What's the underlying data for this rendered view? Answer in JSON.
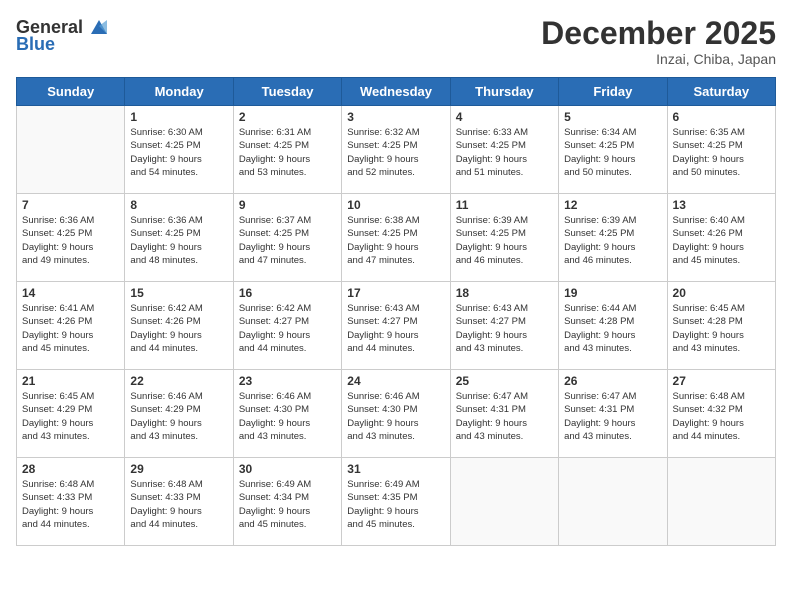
{
  "logo": {
    "general": "General",
    "blue": "Blue"
  },
  "title": "December 2025",
  "location": "Inzai, Chiba, Japan",
  "days_of_week": [
    "Sunday",
    "Monday",
    "Tuesday",
    "Wednesday",
    "Thursday",
    "Friday",
    "Saturday"
  ],
  "weeks": [
    [
      {
        "day": "",
        "lines": []
      },
      {
        "day": "1",
        "lines": [
          "Sunrise: 6:30 AM",
          "Sunset: 4:25 PM",
          "Daylight: 9 hours",
          "and 54 minutes."
        ]
      },
      {
        "day": "2",
        "lines": [
          "Sunrise: 6:31 AM",
          "Sunset: 4:25 PM",
          "Daylight: 9 hours",
          "and 53 minutes."
        ]
      },
      {
        "day": "3",
        "lines": [
          "Sunrise: 6:32 AM",
          "Sunset: 4:25 PM",
          "Daylight: 9 hours",
          "and 52 minutes."
        ]
      },
      {
        "day": "4",
        "lines": [
          "Sunrise: 6:33 AM",
          "Sunset: 4:25 PM",
          "Daylight: 9 hours",
          "and 51 minutes."
        ]
      },
      {
        "day": "5",
        "lines": [
          "Sunrise: 6:34 AM",
          "Sunset: 4:25 PM",
          "Daylight: 9 hours",
          "and 50 minutes."
        ]
      },
      {
        "day": "6",
        "lines": [
          "Sunrise: 6:35 AM",
          "Sunset: 4:25 PM",
          "Daylight: 9 hours",
          "and 50 minutes."
        ]
      }
    ],
    [
      {
        "day": "7",
        "lines": [
          "Sunrise: 6:36 AM",
          "Sunset: 4:25 PM",
          "Daylight: 9 hours",
          "and 49 minutes."
        ]
      },
      {
        "day": "8",
        "lines": [
          "Sunrise: 6:36 AM",
          "Sunset: 4:25 PM",
          "Daylight: 9 hours",
          "and 48 minutes."
        ]
      },
      {
        "day": "9",
        "lines": [
          "Sunrise: 6:37 AM",
          "Sunset: 4:25 PM",
          "Daylight: 9 hours",
          "and 47 minutes."
        ]
      },
      {
        "day": "10",
        "lines": [
          "Sunrise: 6:38 AM",
          "Sunset: 4:25 PM",
          "Daylight: 9 hours",
          "and 47 minutes."
        ]
      },
      {
        "day": "11",
        "lines": [
          "Sunrise: 6:39 AM",
          "Sunset: 4:25 PM",
          "Daylight: 9 hours",
          "and 46 minutes."
        ]
      },
      {
        "day": "12",
        "lines": [
          "Sunrise: 6:39 AM",
          "Sunset: 4:25 PM",
          "Daylight: 9 hours",
          "and 46 minutes."
        ]
      },
      {
        "day": "13",
        "lines": [
          "Sunrise: 6:40 AM",
          "Sunset: 4:26 PM",
          "Daylight: 9 hours",
          "and 45 minutes."
        ]
      }
    ],
    [
      {
        "day": "14",
        "lines": [
          "Sunrise: 6:41 AM",
          "Sunset: 4:26 PM",
          "Daylight: 9 hours",
          "and 45 minutes."
        ]
      },
      {
        "day": "15",
        "lines": [
          "Sunrise: 6:42 AM",
          "Sunset: 4:26 PM",
          "Daylight: 9 hours",
          "and 44 minutes."
        ]
      },
      {
        "day": "16",
        "lines": [
          "Sunrise: 6:42 AM",
          "Sunset: 4:27 PM",
          "Daylight: 9 hours",
          "and 44 minutes."
        ]
      },
      {
        "day": "17",
        "lines": [
          "Sunrise: 6:43 AM",
          "Sunset: 4:27 PM",
          "Daylight: 9 hours",
          "and 44 minutes."
        ]
      },
      {
        "day": "18",
        "lines": [
          "Sunrise: 6:43 AM",
          "Sunset: 4:27 PM",
          "Daylight: 9 hours",
          "and 43 minutes."
        ]
      },
      {
        "day": "19",
        "lines": [
          "Sunrise: 6:44 AM",
          "Sunset: 4:28 PM",
          "Daylight: 9 hours",
          "and 43 minutes."
        ]
      },
      {
        "day": "20",
        "lines": [
          "Sunrise: 6:45 AM",
          "Sunset: 4:28 PM",
          "Daylight: 9 hours",
          "and 43 minutes."
        ]
      }
    ],
    [
      {
        "day": "21",
        "lines": [
          "Sunrise: 6:45 AM",
          "Sunset: 4:29 PM",
          "Daylight: 9 hours",
          "and 43 minutes."
        ]
      },
      {
        "day": "22",
        "lines": [
          "Sunrise: 6:46 AM",
          "Sunset: 4:29 PM",
          "Daylight: 9 hours",
          "and 43 minutes."
        ]
      },
      {
        "day": "23",
        "lines": [
          "Sunrise: 6:46 AM",
          "Sunset: 4:30 PM",
          "Daylight: 9 hours",
          "and 43 minutes."
        ]
      },
      {
        "day": "24",
        "lines": [
          "Sunrise: 6:46 AM",
          "Sunset: 4:30 PM",
          "Daylight: 9 hours",
          "and 43 minutes."
        ]
      },
      {
        "day": "25",
        "lines": [
          "Sunrise: 6:47 AM",
          "Sunset: 4:31 PM",
          "Daylight: 9 hours",
          "and 43 minutes."
        ]
      },
      {
        "day": "26",
        "lines": [
          "Sunrise: 6:47 AM",
          "Sunset: 4:31 PM",
          "Daylight: 9 hours",
          "and 43 minutes."
        ]
      },
      {
        "day": "27",
        "lines": [
          "Sunrise: 6:48 AM",
          "Sunset: 4:32 PM",
          "Daylight: 9 hours",
          "and 44 minutes."
        ]
      }
    ],
    [
      {
        "day": "28",
        "lines": [
          "Sunrise: 6:48 AM",
          "Sunset: 4:33 PM",
          "Daylight: 9 hours",
          "and 44 minutes."
        ]
      },
      {
        "day": "29",
        "lines": [
          "Sunrise: 6:48 AM",
          "Sunset: 4:33 PM",
          "Daylight: 9 hours",
          "and 44 minutes."
        ]
      },
      {
        "day": "30",
        "lines": [
          "Sunrise: 6:49 AM",
          "Sunset: 4:34 PM",
          "Daylight: 9 hours",
          "and 45 minutes."
        ]
      },
      {
        "day": "31",
        "lines": [
          "Sunrise: 6:49 AM",
          "Sunset: 4:35 PM",
          "Daylight: 9 hours",
          "and 45 minutes."
        ]
      },
      {
        "day": "",
        "lines": []
      },
      {
        "day": "",
        "lines": []
      },
      {
        "day": "",
        "lines": []
      }
    ]
  ]
}
